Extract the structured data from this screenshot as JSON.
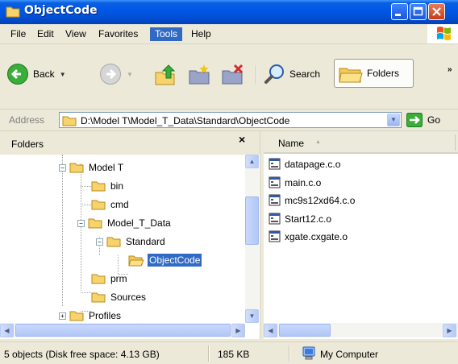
{
  "window": {
    "title": "ObjectCode"
  },
  "menu": {
    "items": [
      "File",
      "Edit",
      "View",
      "Favorites",
      "Tools",
      "Help"
    ],
    "active": "Tools"
  },
  "toolbar": {
    "back_label": "Back",
    "search_label": "Search",
    "folders_label": "Folders",
    "more": "»"
  },
  "address": {
    "label": "Address",
    "value": "D:\\Model T\\Model_T_Data\\Standard\\ObjectCode",
    "go_label": "Go"
  },
  "folders_pane": {
    "title": "Folders",
    "close": "×",
    "tree": [
      {
        "label": "Model T",
        "expander": "−"
      },
      {
        "label": "bin"
      },
      {
        "label": "cmd"
      },
      {
        "label": "Model_T_Data",
        "expander": "−"
      },
      {
        "label": "Standard",
        "expander": "−"
      },
      {
        "label": "ObjectCode",
        "selected": true
      },
      {
        "label": "prm"
      },
      {
        "label": "Sources"
      },
      {
        "label": "Profiles",
        "expander": "+"
      }
    ]
  },
  "file_list": {
    "column_name": "Name",
    "files": [
      "datapage.c.o",
      "main.c.o",
      "mc9s12xd64.c.o",
      "Start12.c.o",
      "xgate.cxgate.o"
    ]
  },
  "status": {
    "objects": "5 objects (Disk free space: 4.13 GB)",
    "size": "185 KB",
    "location": "My Computer"
  },
  "colors": {
    "titlebar": "#0058e6",
    "selection": "#316ac5",
    "chrome": "#ece9d8"
  }
}
